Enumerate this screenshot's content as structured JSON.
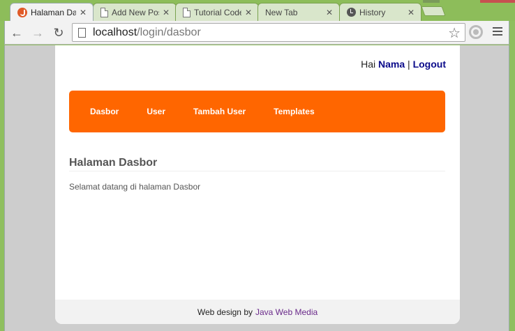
{
  "browser": {
    "tabs": [
      {
        "title": "Halaman Dasbor",
        "icon": "java-favicon",
        "active": true
      },
      {
        "title": "Add New Post",
        "icon": "page-icon",
        "active": false
      },
      {
        "title": "Tutorial Codeigniter",
        "icon": "page-icon",
        "active": false
      },
      {
        "title": "New Tab",
        "icon": "",
        "active": false
      },
      {
        "title": "History",
        "icon": "clock-icon",
        "active": false
      }
    ],
    "close_glyph": "✕",
    "back_glyph": "←",
    "forward_glyph": "→",
    "reload_glyph": "↻",
    "star_glyph": "☆",
    "url_host": "localhost",
    "url_path": "/login/dasbor"
  },
  "page": {
    "greeting": "Hai",
    "user_name": "Nama",
    "separator": "|",
    "logout": "Logout",
    "menu": [
      "Dasbor",
      "User",
      "Tambah User",
      "Templates"
    ],
    "heading": "Halaman Dasbor",
    "welcome": "Selamat datang di halaman Dasbor",
    "footer_prefix": "Web design by",
    "footer_link": "Java Web Media"
  },
  "colors": {
    "menu_bg": "#ff6600",
    "link": "#0a0a8a",
    "footer_link": "#6a2a8a"
  }
}
